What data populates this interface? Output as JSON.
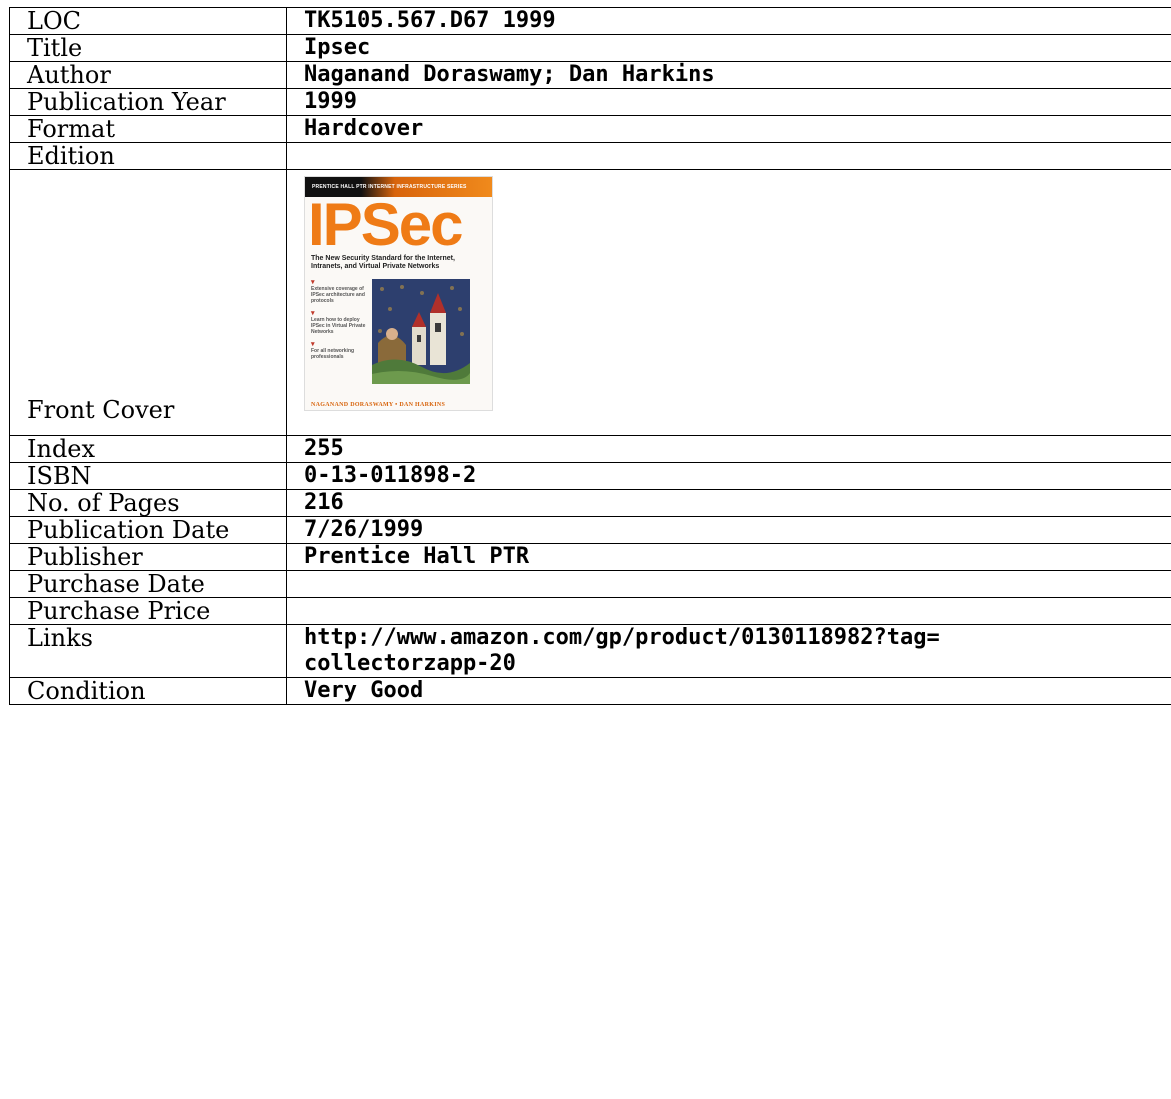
{
  "record": {
    "loc": {
      "label": "LOC",
      "value": "TK5105.567.D67 1999"
    },
    "title": {
      "label": "Title",
      "value": "Ipsec"
    },
    "author": {
      "label": "Author",
      "value": "Naganand Doraswamy; Dan Harkins"
    },
    "publication_year": {
      "label": "Publication Year",
      "value": "1999"
    },
    "format": {
      "label": "Format",
      "value": "Hardcover"
    },
    "edition": {
      "label": "Edition",
      "value": ""
    },
    "front_cover": {
      "label": "Front Cover",
      "cover": {
        "series": "PRENTICE HALL PTR INTERNET INFRASTRUCTURE SERIES",
        "title": "IPSec",
        "subtitle": "The New Security Standard for the Internet, Intranets, and Virtual Private Networks",
        "bullets": [
          "Extensive coverage of IPSec architecture and protocols",
          "Learn how to deploy IPSec in Virtual Private Networks",
          "For all networking professionals"
        ],
        "authors": "NAGANAND DORASWAMY • DAN HARKINS",
        "accent_color": "#ef7b16"
      }
    },
    "index": {
      "label": "Index",
      "value": "255"
    },
    "isbn": {
      "label": "ISBN",
      "value": "0-13-011898-2"
    },
    "pages": {
      "label": "No. of Pages",
      "value": "216"
    },
    "publication_date": {
      "label": "Publication Date",
      "value": "7/26/1999"
    },
    "publisher": {
      "label": "Publisher",
      "value": "Prentice Hall PTR"
    },
    "purchase_date": {
      "label": "Purchase Date",
      "value": ""
    },
    "purchase_price": {
      "label": "Purchase Price",
      "value": ""
    },
    "links": {
      "label": "Links",
      "value_line1": "http://www.amazon.com/gp/product/0130118982?tag=",
      "value_line2": "collectorzapp-20"
    },
    "condition": {
      "label": "Condition",
      "value": "Very Good"
    }
  }
}
